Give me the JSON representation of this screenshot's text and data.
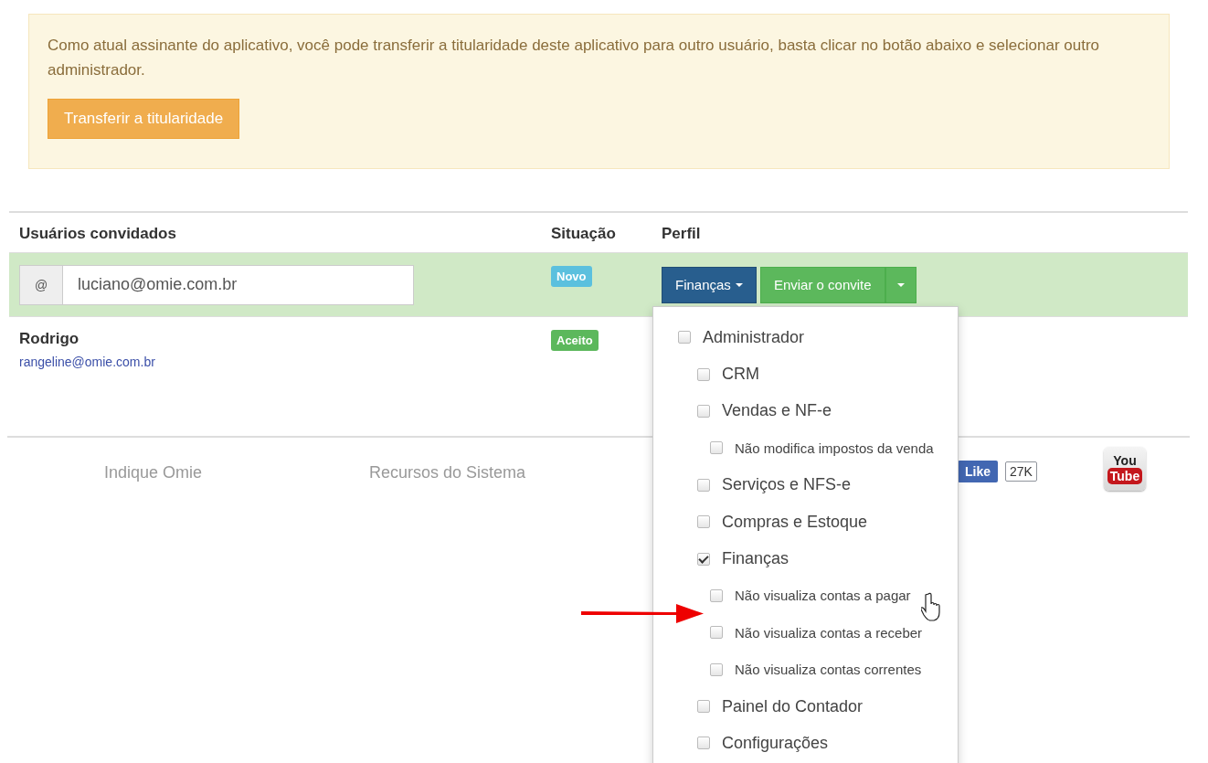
{
  "notice": {
    "text": "Como atual assinante do aplicativo, você pode transferir a titularidade deste aplicativo para outro usuário, basta clicar no botão abaixo e selecionar outro administrador.",
    "button": "Transferir a titularidade"
  },
  "table": {
    "columns": [
      "Usuários convidados",
      "Situação",
      "Perfil"
    ],
    "invite_row": {
      "addon": "@",
      "value": "luciano@omie.com.br",
      "status": "Novo",
      "profile_button": "Finanças",
      "send_button": "Enviar o convite"
    },
    "rows": [
      {
        "name": "Rodrigo",
        "email": "rangeline@omie.com.br",
        "status": "Aceito"
      }
    ]
  },
  "profile_menu": {
    "items": [
      {
        "label": "Administrador",
        "checked": false,
        "children": [
          {
            "label": "CRM",
            "checked": false
          },
          {
            "label": "Vendas e NF-e",
            "checked": false,
            "children": [
              {
                "label": "Não modifica impostos da venda",
                "checked": false
              }
            ]
          },
          {
            "label": "Serviços e NFS-e",
            "checked": false
          },
          {
            "label": "Compras e Estoque",
            "checked": false
          },
          {
            "label": "Finanças",
            "checked": true,
            "children": [
              {
                "label": "Não visualiza contas a pagar",
                "checked": false
              },
              {
                "label": "Não visualiza contas a receber",
                "checked": false
              },
              {
                "label": "Não visualiza contas correntes",
                "checked": false
              }
            ]
          },
          {
            "label": "Painel do Contador",
            "checked": false
          },
          {
            "label": "Configurações",
            "checked": false
          }
        ]
      }
    ]
  },
  "footer": {
    "links": [
      "Indique Omie",
      "Recursos do Sistema"
    ],
    "like": {
      "label": "Like",
      "count": "27K"
    },
    "youtube": {
      "top": "You",
      "bottom": "Tube"
    }
  }
}
